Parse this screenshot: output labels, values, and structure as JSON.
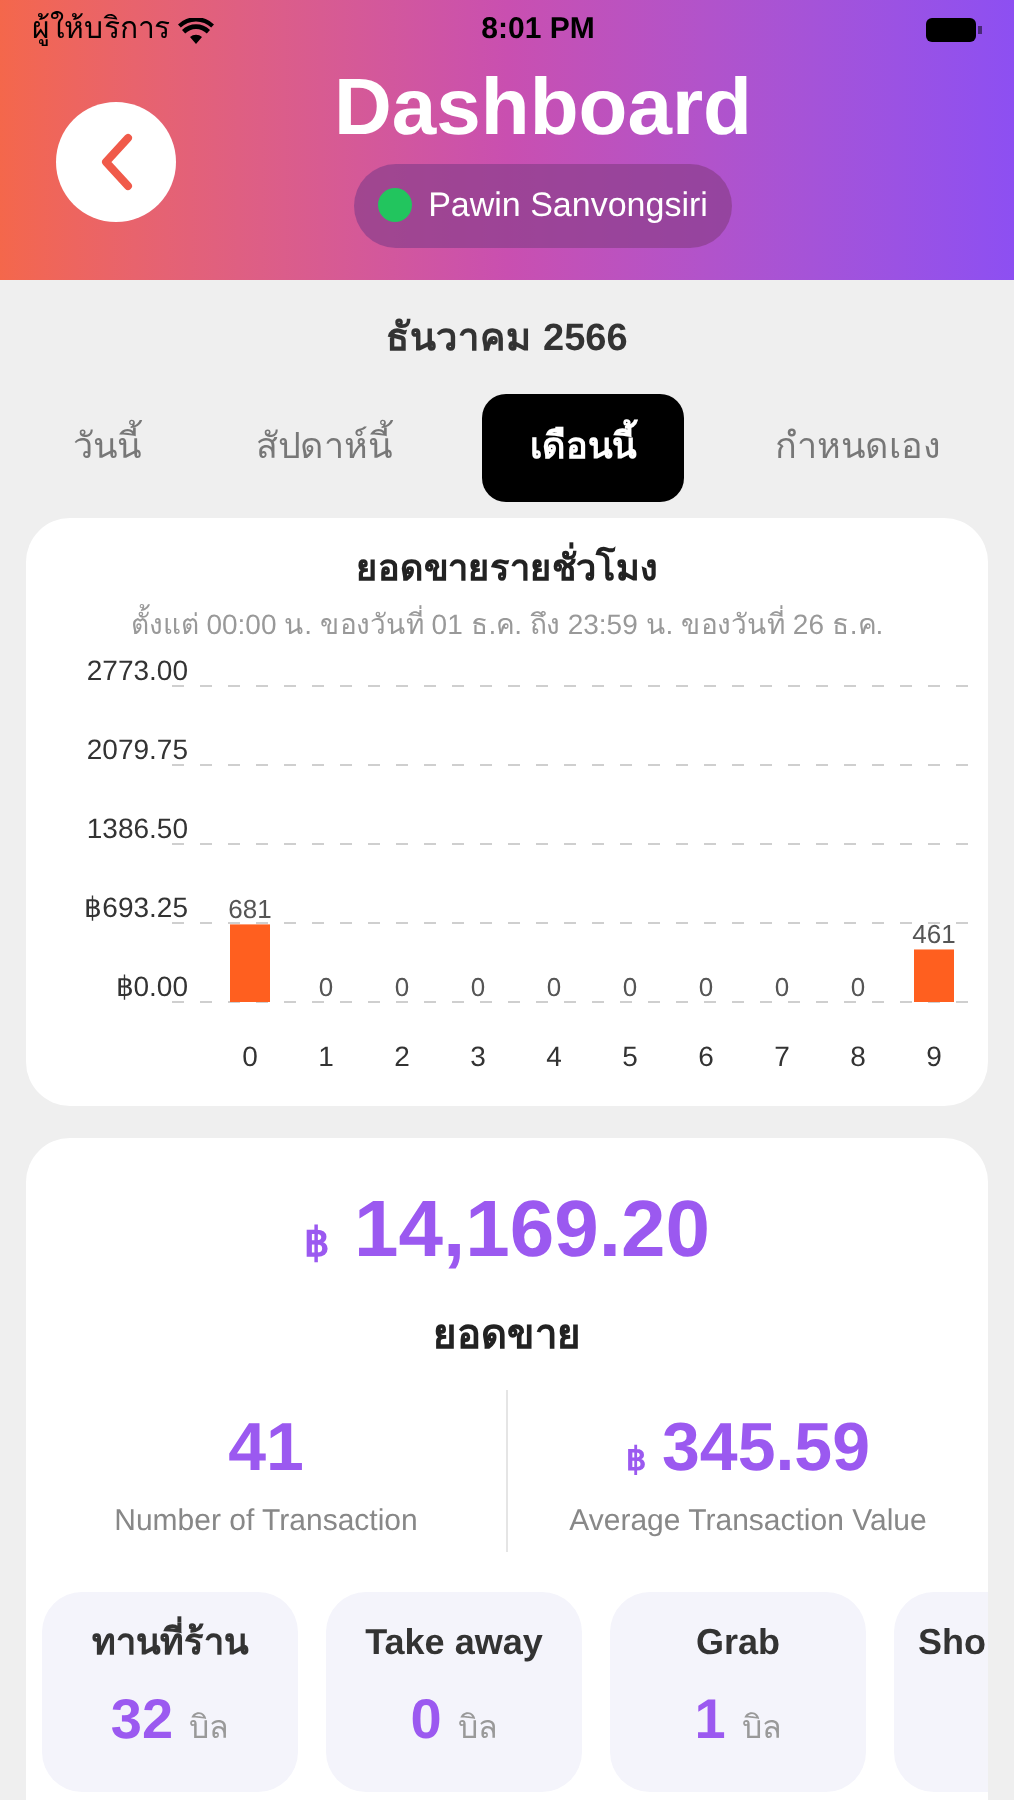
{
  "status_bar": {
    "carrier": "ผู้ให้บริการ",
    "time": "8:01 PM"
  },
  "header": {
    "title": "Dashboard",
    "user": {
      "name": "Pawin Sanvongsiri",
      "online": true
    }
  },
  "period": "ธันวาคม 2566",
  "tabs": [
    {
      "label": "วันนี้",
      "selected": false
    },
    {
      "label": "สัปดาห์นี้",
      "selected": false
    },
    {
      "label": "เดือนนี้",
      "selected": true
    },
    {
      "label": "กำหนดเอง",
      "selected": false
    }
  ],
  "hourly_chart": {
    "title": "ยอดขายรายชั่วโมง",
    "subtitle": "ตั้งแต่ 00:00 น. ของวันที่ 01 ธ.ค. ถึง 23:59 น. ของวันที่ 26 ธ.ค.",
    "chart_data": {
      "type": "bar",
      "categories": [
        "0",
        "1",
        "2",
        "3",
        "4",
        "5",
        "6",
        "7",
        "8",
        "9"
      ],
      "series": [
        {
          "color": "#ff5f1f",
          "values": [
            681,
            0,
            0,
            0,
            0,
            0,
            0,
            0,
            0,
            461
          ]
        }
      ],
      "grid": true,
      "ylim": [
        0,
        2773
      ],
      "yticks": [
        {
          "value": 0,
          "label": "฿0.00"
        },
        {
          "value": 693.25,
          "label": "฿693.25"
        },
        {
          "value": 1386.5,
          "label": "1386.50"
        },
        {
          "value": 2079.75,
          "label": "2079.75"
        },
        {
          "value": 2773,
          "label": "2773.00"
        }
      ],
      "data_labels": true
    }
  },
  "summary": {
    "currency": "฿",
    "total": "14,169.20",
    "total_label": "ยอดขาย",
    "transactions": {
      "value": "41",
      "label": "Number of Transaction"
    },
    "average": {
      "currency": "฿",
      "value": "345.59",
      "label": "Average Transaction Value"
    }
  },
  "channels": [
    {
      "name": "ทานที่ร้าน",
      "count": "32",
      "unit": "บิล"
    },
    {
      "name": "Take away",
      "count": "0",
      "unit": "บิล"
    },
    {
      "name": "Grab",
      "count": "1",
      "unit": "บิล"
    },
    {
      "name": "Sho"
    }
  ]
}
